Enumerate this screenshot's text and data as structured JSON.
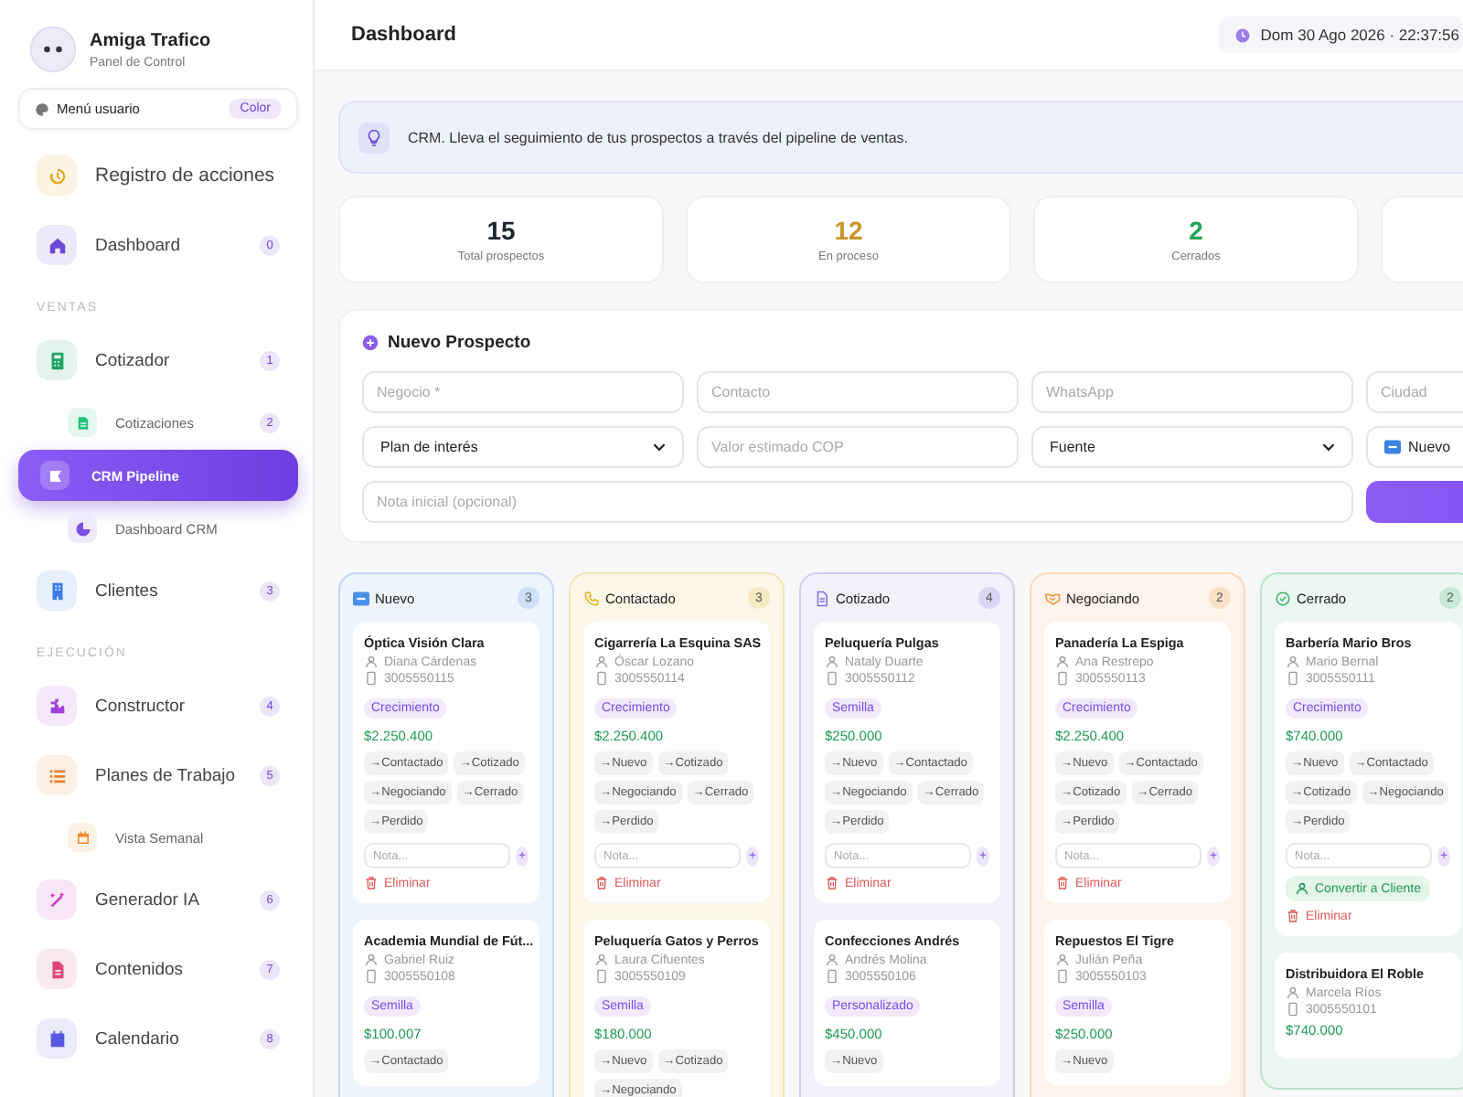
{
  "brand": {
    "title": "Amiga Trafico",
    "subtitle": "Panel de Control"
  },
  "user_menu": {
    "label": "Menú usuario",
    "badge": "Color"
  },
  "sidebar": {
    "items": [
      {
        "kind": "item",
        "label": "Registro de acciones",
        "color": "#e8a317",
        "selected": false,
        "large": true
      },
      {
        "kind": "item",
        "label": "Dashboard",
        "badge": "0",
        "color": "#6a4ad8",
        "selected": false
      },
      {
        "kind": "section",
        "label": "VENTAS"
      },
      {
        "kind": "item",
        "label": "Cotizador",
        "badge": "1",
        "color": "#21a366",
        "selected": false,
        "children": [
          {
            "label": "Cotizaciones",
            "badge": "2",
            "color": "#21c27a",
            "selected": false
          },
          {
            "label": "CRM Pipeline",
            "color": "#ffffff",
            "selected": true
          },
          {
            "label": "Dashboard CRM",
            "color": "#7b4fe0",
            "selected": false
          }
        ]
      },
      {
        "kind": "item",
        "label": "Clientes",
        "badge": "3",
        "color": "#3b7de8",
        "selected": false
      },
      {
        "kind": "section",
        "label": "EJECUCIÓN"
      },
      {
        "kind": "item",
        "label": "Constructor",
        "badge": "4",
        "color": "#a040d8",
        "selected": false
      },
      {
        "kind": "item",
        "label": "Planes de Trabajo",
        "badge": "5",
        "color": "#e8812a",
        "selected": false,
        "children": [
          {
            "label": "Vista Semanal",
            "color": "#f08a2a",
            "selected": false
          }
        ]
      },
      {
        "kind": "item",
        "label": "Generador IA",
        "badge": "6",
        "color": "#d03ad0",
        "selected": false
      },
      {
        "kind": "item",
        "label": "Contenidos",
        "badge": "7",
        "color": "#e0457a",
        "selected": false
      },
      {
        "kind": "item",
        "label": "Calendario",
        "badge": "8",
        "color": "#5a5ae0",
        "selected": false
      }
    ]
  },
  "header": {
    "title": "Dashboard",
    "datetime": "Dom 30 Ago 2026 · 22:37:56"
  },
  "banner": "CRM. Lleva el seguimiento de tus prospectos a través del pipeline de ventas.",
  "stats": [
    {
      "value": "15",
      "label": "Total prospectos",
      "color": "#1f2430"
    },
    {
      "value": "12",
      "label": "En proceso",
      "color": "#c9942a"
    },
    {
      "value": "2",
      "label": "Cerrados",
      "color": "#23a158"
    }
  ],
  "form": {
    "title": "Nuevo Prospecto",
    "fields": [
      {
        "kind": "input",
        "placeholder": "Negocio *"
      },
      {
        "kind": "input",
        "placeholder": "Contacto"
      },
      {
        "kind": "input",
        "placeholder": "WhatsApp"
      },
      {
        "kind": "input",
        "placeholder": "Ciudad"
      },
      {
        "kind": "select",
        "value": "Plan de interés"
      },
      {
        "kind": "input",
        "placeholder": "Valor estimado COP"
      },
      {
        "kind": "select",
        "value": "Fuente"
      },
      {
        "kind": "status",
        "value": "Nuevo"
      },
      {
        "kind": "note",
        "placeholder": "Nota inicial (opcional)"
      },
      {
        "kind": "submit"
      }
    ]
  },
  "columns": [
    {
      "title": "Nuevo",
      "count": "3",
      "color": "#4a8fe7",
      "cards": [
        {
          "name": "Óptica Visión Clara",
          "contact": "Diana Cárdenas",
          "phone": "3005550115",
          "plan": "Crecimiento",
          "value": "$2.250.400",
          "moves": [
            "→Contactado",
            "→Cotizado",
            "→Negociando",
            "→Cerrado",
            "→Perdido"
          ],
          "note_placeholder": "Nota...",
          "add_label": "+",
          "delete_label": "Eliminar"
        },
        {
          "name": "Academia Mundial de Fút...",
          "contact": "Gabriel Ruiz",
          "phone": "3005550108",
          "plan": "Semilla",
          "value": "$100.007",
          "moves": [
            "→Contactado"
          ]
        }
      ]
    },
    {
      "title": "Contactado",
      "count": "3",
      "color": "#e2b320",
      "cards": [
        {
          "name": "Cigarrería La Esquina SAS",
          "contact": "Óscar Lozano",
          "phone": "3005550114",
          "plan": "Crecimiento",
          "value": "$2.250.400",
          "moves": [
            "→Nuevo",
            "→Cotizado",
            "→Negociando",
            "→Cerrado",
            "→Perdido"
          ],
          "note_placeholder": "Nota...",
          "add_label": "+",
          "delete_label": "Eliminar"
        },
        {
          "name": "Peluquería Gatos y Perros",
          "contact": "Laura Cifuentes",
          "phone": "3005550109",
          "plan": "Semilla",
          "value": "$180.000",
          "moves": [
            "→Nuevo",
            "→Cotizado",
            "→Negociando"
          ]
        }
      ]
    },
    {
      "title": "Cotizado",
      "count": "4",
      "color": "#7c6fe0",
      "cards": [
        {
          "name": "Peluquería Pulgas",
          "contact": "Nataly Duarte",
          "phone": "3005550112",
          "plan": "Semilla",
          "value": "$250.000",
          "moves": [
            "→Nuevo",
            "→Contactado",
            "→Negociando",
            "→Cerrado",
            "→Perdido"
          ],
          "note_placeholder": "Nota...",
          "add_label": "+",
          "delete_label": "Eliminar"
        },
        {
          "name": "Confecciones Andrés",
          "contact": "Andrés Molina",
          "phone": "3005550106",
          "plan": "Personalizado",
          "value": "$450.000",
          "moves": [
            "→Nuevo"
          ]
        }
      ]
    },
    {
      "title": "Negociando",
      "count": "2",
      "color": "#f0913a",
      "cards": [
        {
          "name": "Panadería La Espiga",
          "contact": "Ana Restrepo",
          "phone": "3005550113",
          "plan": "Crecimiento",
          "value": "$2.250.400",
          "moves": [
            "→Nuevo",
            "→Contactado",
            "→Cotizado",
            "→Cerrado",
            "→Perdido"
          ],
          "note_placeholder": "Nota...",
          "add_label": "+",
          "delete_label": "Eliminar"
        },
        {
          "name": "Repuestos El Tigre",
          "contact": "Julián Peña",
          "phone": "3005550103",
          "plan": "Semilla",
          "value": "$250.000",
          "moves": [
            "→Nuevo"
          ]
        }
      ]
    },
    {
      "title": "Cerrado",
      "count": "2",
      "color": "#34b36a",
      "cards": [
        {
          "name": "Barbería Mario Bros",
          "contact": "Mario Bernal",
          "phone": "3005550111",
          "plan": "Crecimiento",
          "value": "$740.000",
          "moves": [
            "→Nuevo",
            "→Contactado",
            "→Cotizado",
            "→Negociando",
            "→Perdido"
          ],
          "note_placeholder": "Nota...",
          "add_label": "+",
          "convert_label": "Convertir a Cliente",
          "delete_label": "Eliminar"
        },
        {
          "name": "Distribuidora El Roble",
          "contact": "Marcela Ríos",
          "phone": "3005550101",
          "value": "$740.000"
        }
      ]
    }
  ]
}
